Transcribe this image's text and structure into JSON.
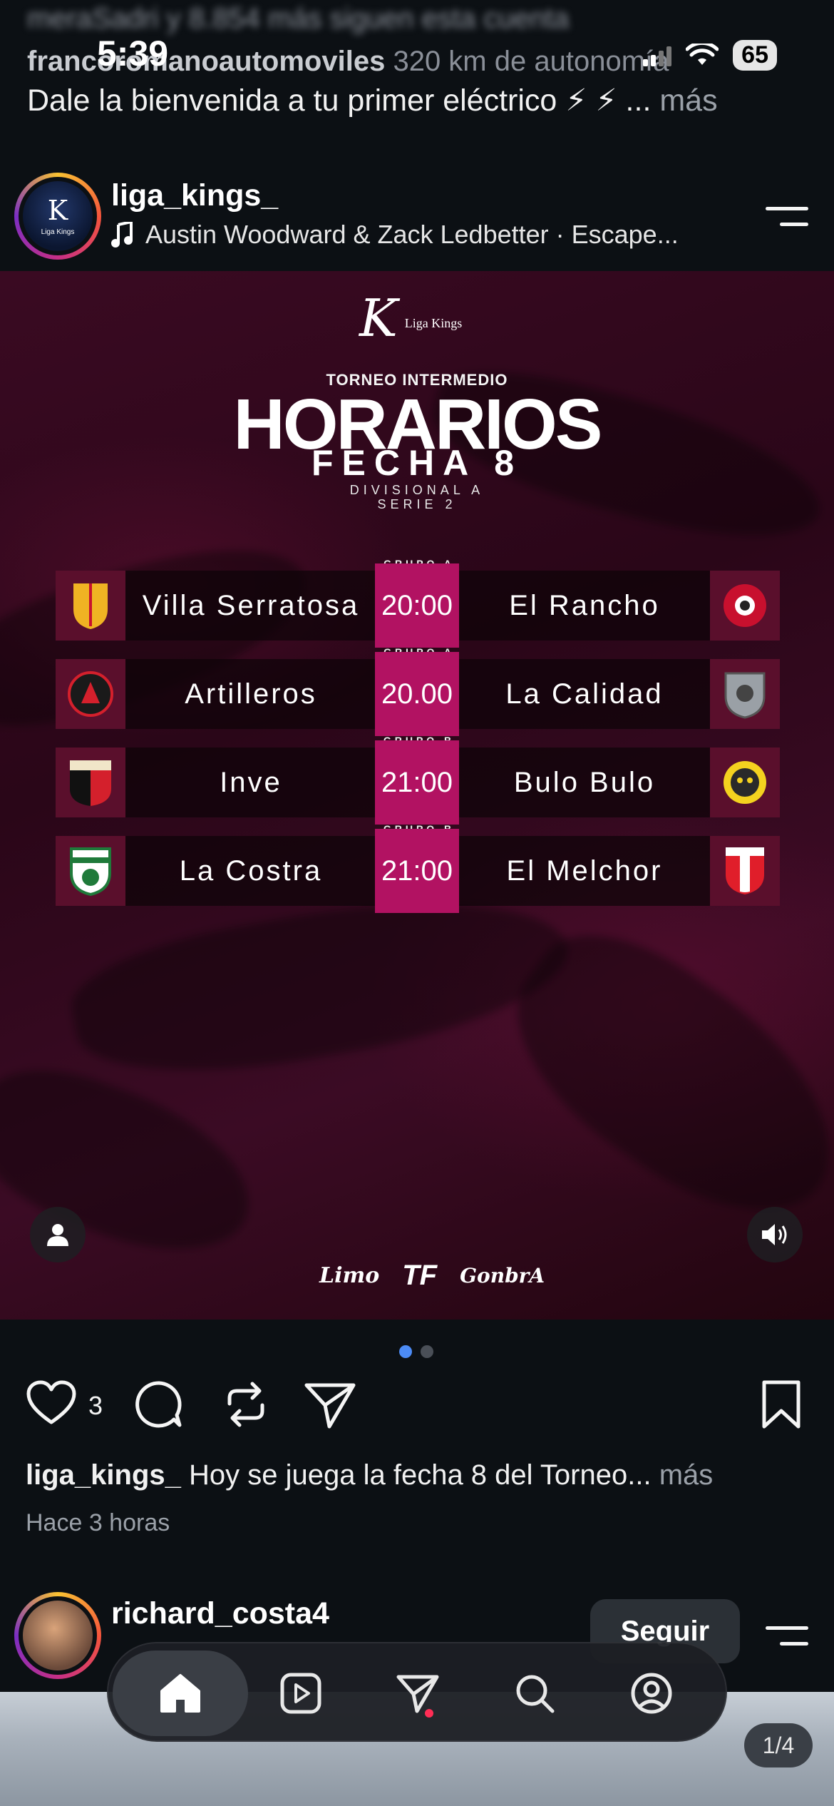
{
  "status_bar": {
    "time": "5:39",
    "battery": "65"
  },
  "previous_post": {
    "followers_line": "meraSadri y 8.854 más siguen esta cuenta",
    "account": "francoromanoautomoviles",
    "account_text": "320 km de autonomía",
    "caption": "Dale la bienvenida a tu primer eléctrico ⚡ ⚡ ...",
    "more_label": "más"
  },
  "post": {
    "username": "liga_kings_",
    "audio": "Austin Woodward & Zack Ledbetter · Escape...",
    "avatar_text": "Liga Kings",
    "graphic": {
      "brand": "Liga Kings",
      "torneo": "TORNEO INTERMEDIO",
      "title": "HORARIOS",
      "fecha": "FECHA 8",
      "division_line1": "DIVISIONAL A",
      "division_line2": "SERIE 2",
      "matches": [
        {
          "group": "GRUPO A",
          "home": "Villa Serratosa",
          "time": "20:00",
          "away": "El Rancho",
          "home_color": "#f0b323",
          "away_color": "#c8102e"
        },
        {
          "group": "GRUPO A",
          "home": "Artilleros",
          "time": "20.00",
          "away": "La Calidad",
          "home_color": "#d4202c",
          "away_color": "#9aa0a6"
        },
        {
          "group": "GRUPO B",
          "home": "Inve",
          "time": "21:00",
          "away": "Bulo Bulo",
          "home_color": "#111111",
          "away_color": "#f4d21f"
        },
        {
          "group": "GRUPO B",
          "home": "La Costra",
          "time": "21:00",
          "away": "El Melchor",
          "home_color": "#1f7a3a",
          "away_color": "#e01e2a"
        }
      ],
      "sponsors": [
        "Limo",
        "TF",
        "GonbrA"
      ]
    },
    "carousel": {
      "total": 2,
      "active": 1
    },
    "likes": "3",
    "caption_user": "liga_kings_",
    "caption_text": "Hoy se juega la fecha 8 del Torneo...",
    "more_label": "más",
    "time_ago": "Hace 3 horas"
  },
  "next_post": {
    "username": "richard_costa4",
    "follow_label": "Seguir",
    "page_indicator": "1/4"
  },
  "colors": {
    "accent_blue": "#4c8bf5",
    "time_box": "#b21262",
    "notif": "#ff2d55"
  }
}
